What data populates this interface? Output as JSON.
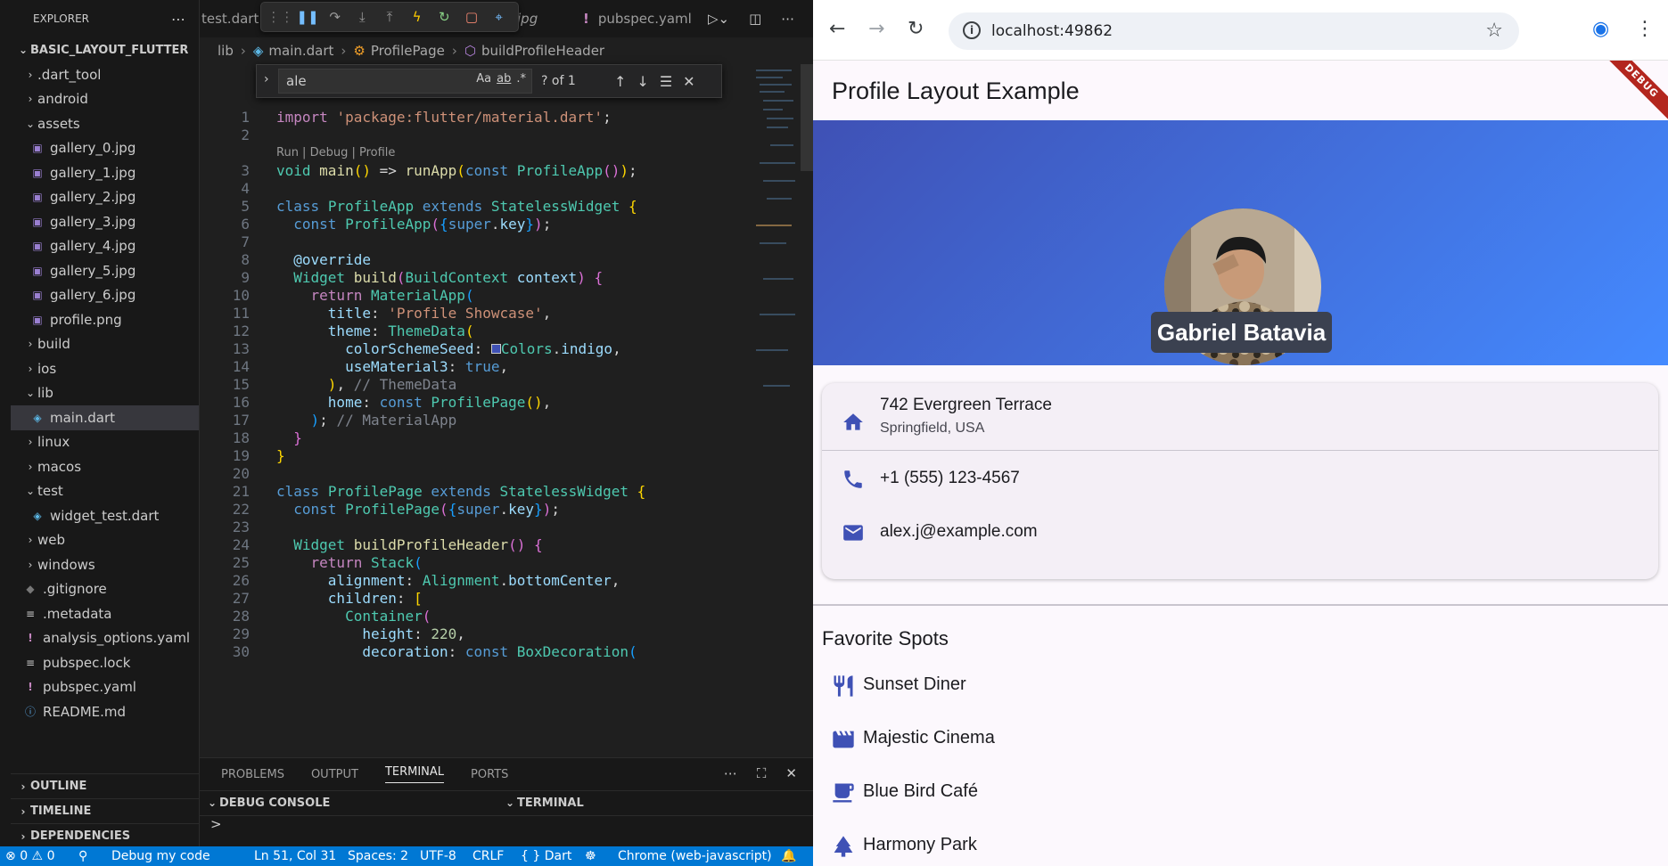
{
  "vscode": {
    "explorer_title": "EXPLORER",
    "project": "BASIC_LAYOUT_FLUTTER",
    "tree": [
      {
        "label": ".dart_tool",
        "kind": "folder",
        "depth": 1,
        "open": false
      },
      {
        "label": "android",
        "kind": "folder",
        "depth": 1,
        "open": false
      },
      {
        "label": "assets",
        "kind": "folder",
        "depth": 1,
        "open": true
      },
      {
        "label": "gallery_0.jpg",
        "kind": "image",
        "depth": 2
      },
      {
        "label": "gallery_1.jpg",
        "kind": "image",
        "depth": 2
      },
      {
        "label": "gallery_2.jpg",
        "kind": "image",
        "depth": 2
      },
      {
        "label": "gallery_3.jpg",
        "kind": "image",
        "depth": 2
      },
      {
        "label": "gallery_4.jpg",
        "kind": "image",
        "depth": 2
      },
      {
        "label": "gallery_5.jpg",
        "kind": "image",
        "depth": 2
      },
      {
        "label": "gallery_6.jpg",
        "kind": "image",
        "depth": 2
      },
      {
        "label": "profile.png",
        "kind": "image",
        "depth": 2
      },
      {
        "label": "build",
        "kind": "folder",
        "depth": 1,
        "open": false
      },
      {
        "label": "ios",
        "kind": "folder",
        "depth": 1,
        "open": false
      },
      {
        "label": "lib",
        "kind": "folder",
        "depth": 1,
        "open": true
      },
      {
        "label": "main.dart",
        "kind": "dart",
        "depth": 2,
        "selected": true
      },
      {
        "label": "linux",
        "kind": "folder",
        "depth": 1,
        "open": false
      },
      {
        "label": "macos",
        "kind": "folder",
        "depth": 1,
        "open": false
      },
      {
        "label": "test",
        "kind": "folder",
        "depth": 1,
        "open": true
      },
      {
        "label": "widget_test.dart",
        "kind": "dart",
        "depth": 2
      },
      {
        "label": "web",
        "kind": "folder",
        "depth": 1,
        "open": false
      },
      {
        "label": "windows",
        "kind": "folder",
        "depth": 1,
        "open": false
      },
      {
        "label": ".gitignore",
        "kind": "git",
        "depth": 1
      },
      {
        "label": ".metadata",
        "kind": "lines",
        "depth": 1
      },
      {
        "label": "analysis_options.yaml",
        "kind": "yaml",
        "depth": 1
      },
      {
        "label": "pubspec.lock",
        "kind": "lines",
        "depth": 1
      },
      {
        "label": "pubspec.yaml",
        "kind": "yaml",
        "depth": 1
      },
      {
        "label": "README.md",
        "kind": "info",
        "depth": 1
      }
    ],
    "sections": [
      "OUTLINE",
      "TIMELINE",
      "DEPENDENCIES"
    ],
    "tabs": {
      "left_tab": "test.dart",
      "mid_tab": "jpg",
      "right_tab": "pubspec.yaml"
    },
    "breadcrumb": [
      "lib",
      "main.dart",
      "ProfilePage",
      "buildProfileHeader"
    ],
    "find": {
      "query": "ale",
      "count": "? of 1",
      "opt_case": "Aa",
      "opt_word": "ab",
      "opt_regex": ".*"
    },
    "code_lens": "Run | Debug | Profile",
    "panel_tabs": [
      "PROBLEMS",
      "OUTPUT",
      "TERMINAL",
      "PORTS"
    ],
    "panel_active": "TERMINAL",
    "panel_left": "DEBUG CONSOLE",
    "panel_right": "TERMINAL",
    "panel_prompt": ">",
    "status": {
      "errors": "0",
      "warnings": "0",
      "debug": "Debug my code",
      "position": "Ln 51, Col 31",
      "spaces": "Spaces: 2",
      "encoding": "UTF-8",
      "eol": "CRLF",
      "language": "Dart",
      "target": "Chrome (web-javascript)"
    }
  },
  "browser": {
    "url": "localhost:49862",
    "app_title": "Profile Layout Example",
    "debug_banner": "DEBUG",
    "profile_name": "Gabriel Batavia",
    "address_line1": "742 Evergreen Terrace",
    "address_line2": "Springfield, USA",
    "phone": "+1 (555) 123-4567",
    "email": "alex.j@example.com",
    "favorites_title": "Favorite Spots",
    "favorites": [
      {
        "label": "Sunset Diner",
        "icon": "restaurant-icon"
      },
      {
        "label": "Majestic Cinema",
        "icon": "movie-icon"
      },
      {
        "label": "Blue Bird Café",
        "icon": "cafe-icon"
      },
      {
        "label": "Harmony Park",
        "icon": "park-icon"
      }
    ],
    "colors": {
      "primary": "#3f51b5",
      "gradient_end": "#448aff",
      "icon": "#3f51b5"
    }
  }
}
